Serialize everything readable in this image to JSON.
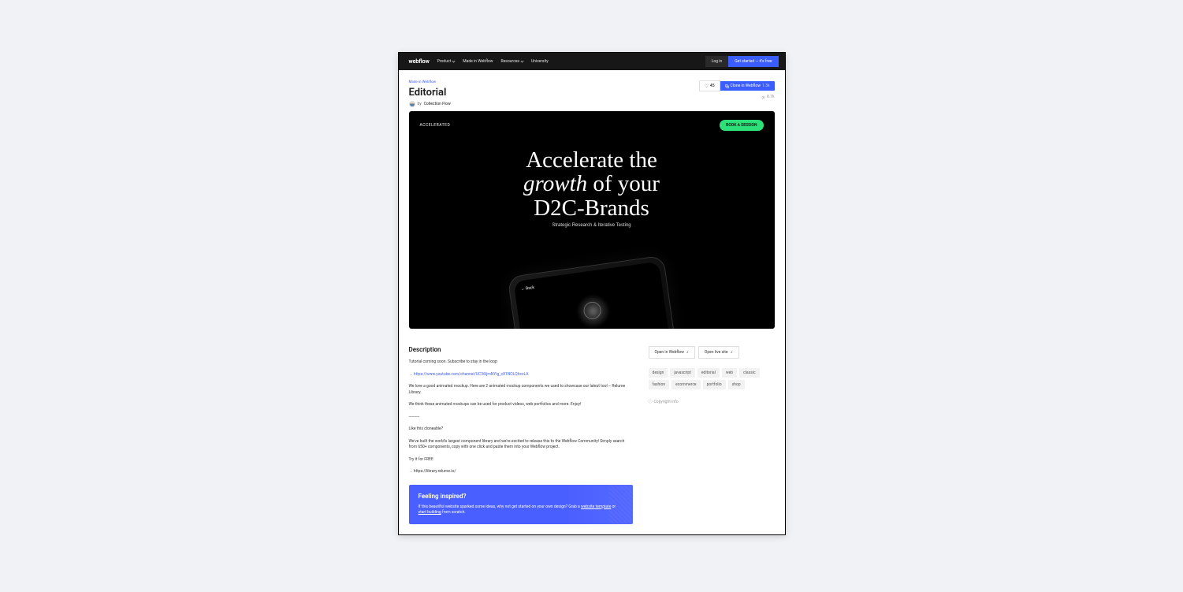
{
  "topbar": {
    "logo": "webflow",
    "nav": [
      {
        "label": "Product",
        "has_chevron": true
      },
      {
        "label": "Made in Webflow",
        "has_chevron": false
      },
      {
        "label": "Resources",
        "has_chevron": true
      },
      {
        "label": "University",
        "has_chevron": false
      }
    ],
    "login": "Log in",
    "get_started": "Get started — it's free"
  },
  "page": {
    "breadcrumb": "Made in Webflow",
    "title": "Editorial",
    "by_label": "by",
    "author": "Collection Flow",
    "like_count": "45",
    "clone_label": "Clone in Webflow",
    "clone_count": "1.3k",
    "views": "8.7k"
  },
  "preview": {
    "badge": "ACCELERATED",
    "cta": "BOOK A SESSION",
    "hero_line1_a": "Accelerate the",
    "hero_line2_a": "growth",
    "hero_line2_b": " of your",
    "hero_line3": "D2C-Brands",
    "subhead": "Strategic Research & Iterative Testing",
    "phone_back": "← Back"
  },
  "description": {
    "heading": "Description",
    "p1": "Tutorial coming soon. Subscribe to stay in the loop",
    "link_prefix": "→ ",
    "link": "https://www.youtube.com/channel/UC36ljmNYig_c81NOLQhcxLA",
    "p2": "We love a good animated mockup. Here are 2 animated mockup components we used to showcase our latest tool – Relume Library.",
    "p3": "We think these animated mockups can be used for product videos, web portfolios and more. Enjoy!",
    "divider": "----------",
    "p4": "Like this cloneable?",
    "p5": "We've built the world's largest component library and we're excited to release this to the Webflow Community! Simply search from 650+ components, copy with one click and paste them into your Webflow project.",
    "p6": "Try it for FREE",
    "p7": "→ https://library.relume.io/"
  },
  "sidebar": {
    "open_webflow": "Open in Webflow",
    "open_live": "Open live site",
    "tags": [
      "design",
      "javascript",
      "editorial",
      "web",
      "classic",
      "fashion",
      "ecommerce",
      "portfolio",
      "shop"
    ],
    "copyright": "Copyright info"
  },
  "inspired": {
    "title": "Feeling inspired?",
    "text_a": "If this beautiful website sparked some ideas, why not get started on your own design? Grab a ",
    "link1": "website template",
    "text_b": " or ",
    "link2": "start building",
    "text_c": " from scratch."
  }
}
